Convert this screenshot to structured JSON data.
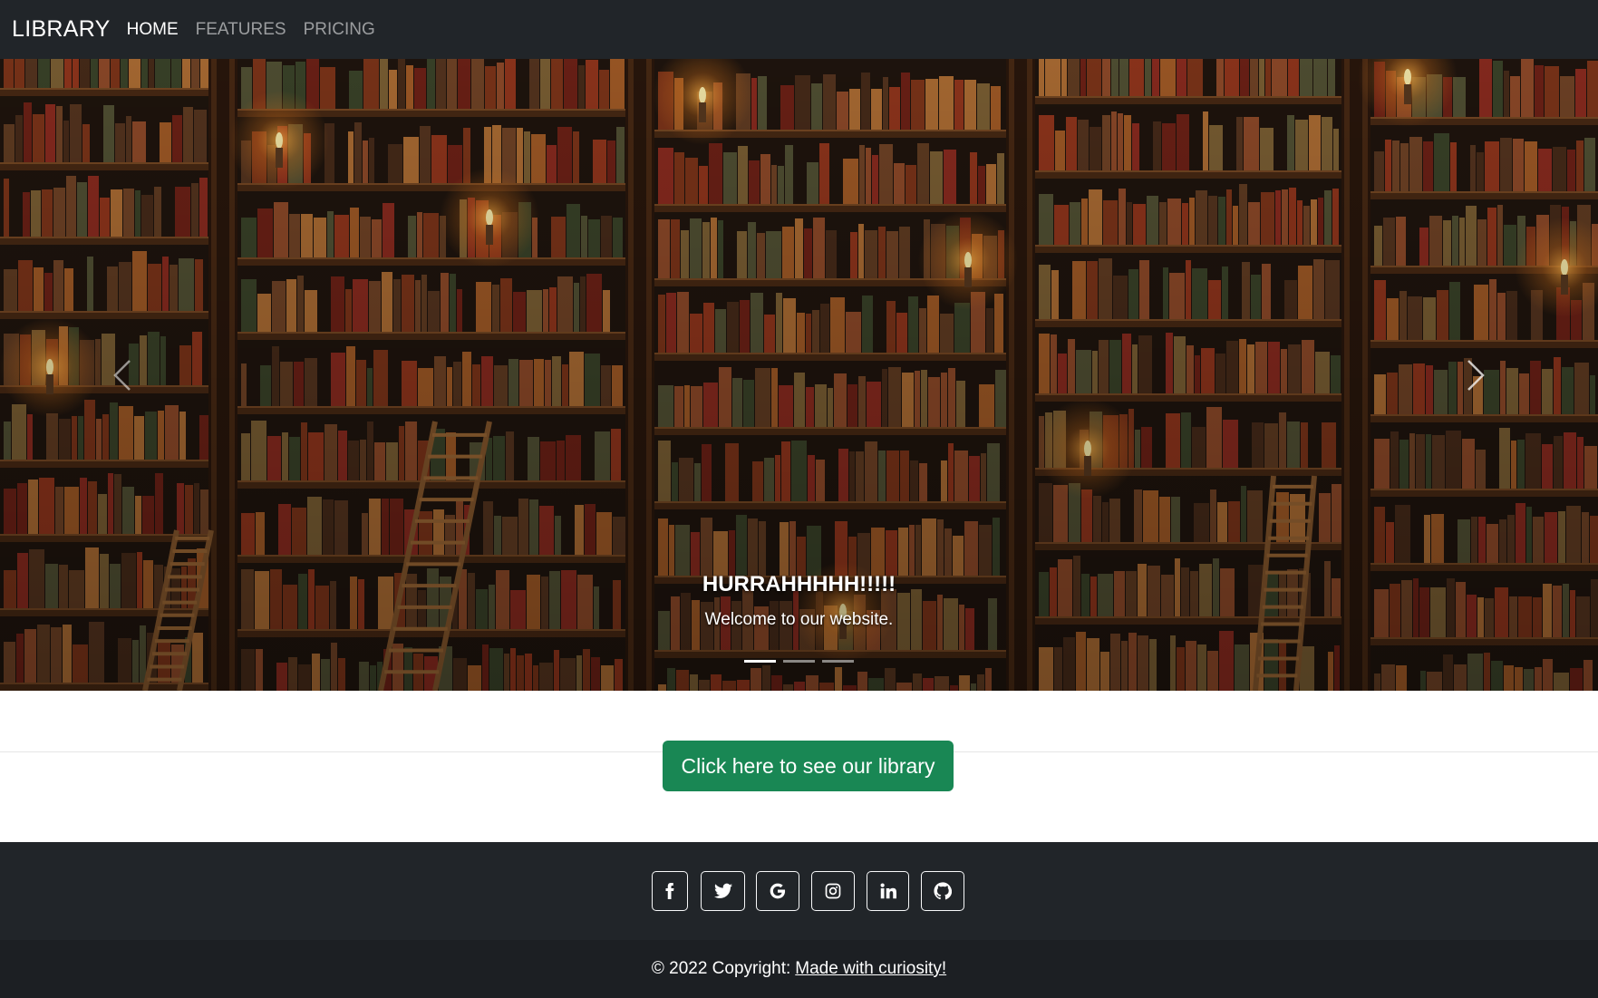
{
  "navbar": {
    "brand": "LIBRARY",
    "links": [
      {
        "label": "HOME",
        "active": true
      },
      {
        "label": "FEATURES",
        "active": false
      },
      {
        "label": "PRICING",
        "active": false
      }
    ]
  },
  "carousel": {
    "caption_title": "HURRAHHHHH!!!!!",
    "caption_text": "Welcome to our website.",
    "slide_count": 3,
    "active_slide": 1,
    "prev_icon": "chevron-left-icon",
    "next_icon": "chevron-right-icon"
  },
  "cta": {
    "button_label": "Click here to see our library",
    "color": "#198754"
  },
  "footer": {
    "social_icons": [
      "facebook-icon",
      "twitter-icon",
      "google-icon",
      "instagram-icon",
      "linkedin-icon",
      "github-icon"
    ],
    "copyright_prefix": "© 2022 Copyright:",
    "copyright_link": "Made with curiosity!"
  },
  "colors": {
    "navbar_bg": "#212529",
    "footer_bg": "#212529",
    "copyright_bg": "#1c1f23"
  }
}
